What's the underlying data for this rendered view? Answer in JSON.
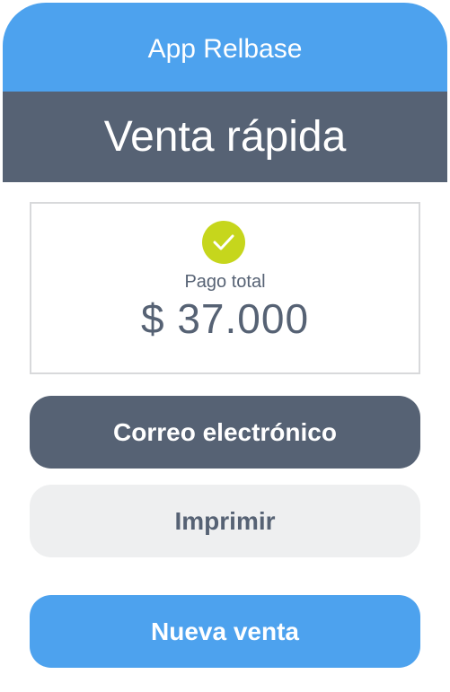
{
  "header": {
    "app_title": "App Relbase",
    "section_title": "Venta rápida"
  },
  "payment": {
    "label": "Pago total",
    "amount": "$ 37.000",
    "status_icon": "check-icon"
  },
  "actions": {
    "email_label": "Correo electrónico",
    "print_label": "Imprimir",
    "new_sale_label": "Nueva venta"
  },
  "colors": {
    "primary_blue": "#4da2ee",
    "slate": "#566274",
    "success_green": "#c6d61c",
    "light_gray": "#eeeff0"
  }
}
